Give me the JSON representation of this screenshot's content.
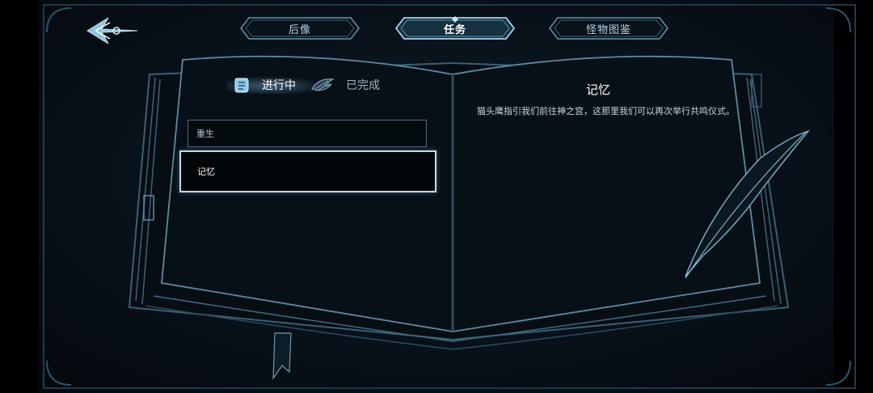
{
  "top_tabs": [
    {
      "label": "后像",
      "active": false
    },
    {
      "label": "任务",
      "active": true
    },
    {
      "label": "怪物图鉴",
      "active": false
    }
  ],
  "quest_tabs": {
    "in_progress": {
      "label": "进行中",
      "icon": "scroll-icon",
      "active": true
    },
    "completed": {
      "label": "已完成",
      "icon": "wing-icon",
      "active": false
    }
  },
  "quests": [
    {
      "name": "重生",
      "selected": false
    },
    {
      "name": "记忆",
      "selected": true
    }
  ],
  "detail": {
    "title": "记忆",
    "description": "猫头鹰指引我们前往神之宫，这那里我们可以再次举行共鸣仪式。"
  },
  "colors": {
    "accent": "#6fb6e0",
    "line": "#5e8aa3",
    "background": "#08111a"
  }
}
